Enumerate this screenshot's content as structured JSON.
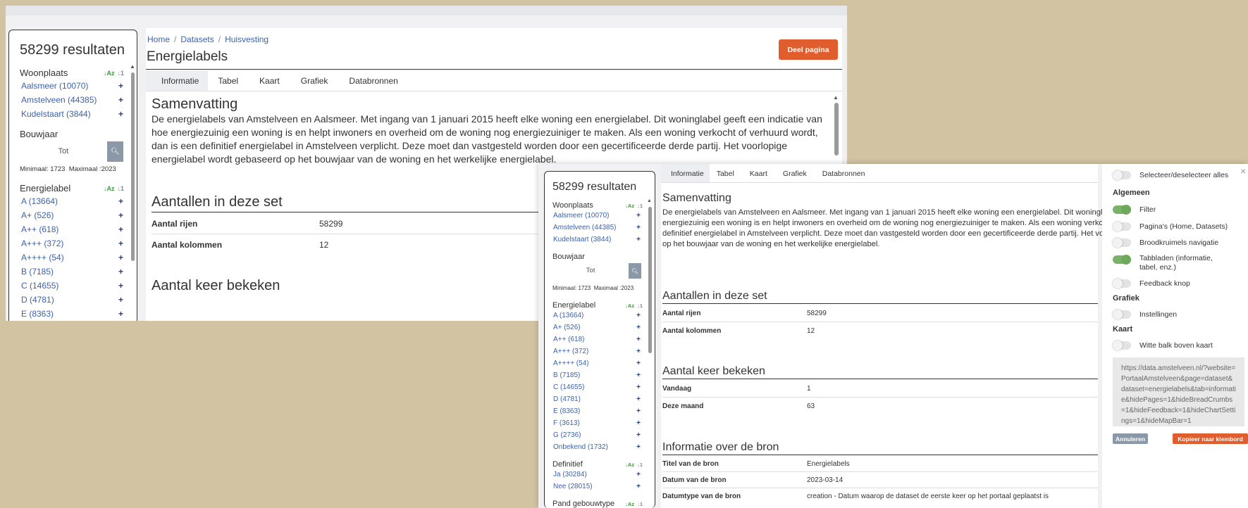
{
  "results_label": "58299 resultaten",
  "filters": {
    "woonplaats": {
      "title": "Woonplaats",
      "items": [
        "Aalsmeer (10070)",
        "Amstelveen (44385)",
        "Kudelstaart (3844)"
      ]
    },
    "bouwjaar": {
      "title": "Bouwjaar",
      "placeholder": "Tot",
      "min_label": "Minimaal: 1723",
      "max_label": "Maximaal :2023"
    },
    "energielabel": {
      "title": "Energielabel",
      "items": [
        "A (13664)",
        "A+ (526)",
        "A++ (618)",
        "A+++ (372)",
        "A++++ (54)",
        "B (7185)",
        "C (14655)",
        "D (4781)",
        "E (8363)",
        "F (3613)",
        "G (2736)",
        "Onbekend (1732)"
      ]
    },
    "definitief": {
      "title": "Definitief",
      "items": [
        "Ja (30284)",
        "Nee (28015)"
      ]
    },
    "pand": {
      "title": "Pand gebouwtype"
    },
    "plus": "+",
    "sort_az": "↓Az",
    "sort_num": "↓1"
  },
  "breadcrumb": [
    "Home",
    "Datasets",
    "Huisvesting"
  ],
  "breadcrumb_sep": "/",
  "page_title": "Energielabels",
  "share_button": "Deel pagina",
  "tabs": [
    "Informatie",
    "Tabel",
    "Kaart",
    "Grafiek",
    "Databronnen"
  ],
  "summary": {
    "title": "Samenvatting",
    "text": "De energielabels van Amstelveen en Aalsmeer. Met ingang van 1 januari 2015 heeft elke woning een energielabel. Dit woninglabel geeft een indicatie van hoe energiezuinig een woning is en helpt inwoners en overheid om de woning nog energiezuiniger te maken. Als een woning verkocht of verhuurd wordt, dan is een definitief energielabel in Amstelveen verplicht. Deze moet dan vastgesteld worden door een gecertificeerde derde partij. Het voorlopige energielabel wordt gebaseerd op het bouwjaar van de woning en het werkelijke energielabel."
  },
  "counts": {
    "title": "Aantallen in deze set",
    "rows": [
      {
        "k": "Aantal rijen",
        "v": "58299"
      },
      {
        "k": "Aantal kolommen",
        "v": "12"
      }
    ]
  },
  "views": {
    "title": "Aantal keer bekeken",
    "rows": [
      {
        "k": "Vandaag",
        "v": "1"
      },
      {
        "k": "Deze maand",
        "v": "63"
      }
    ]
  },
  "source": {
    "title": "Informatie over de bron",
    "rows": [
      {
        "k": "Titel van de bron",
        "v": "Energielabels"
      },
      {
        "k": "Datum van de bron",
        "v": "2023-03-14"
      },
      {
        "k": "Datumtype van de bron",
        "v": "creation - Datum waarop de dataset de eerste keer op het portaal geplaatst is"
      }
    ]
  },
  "embed_panel": {
    "close": "×",
    "select_all": "Selecteer/deselecteer alles",
    "groups": {
      "algemeen": "Algemeen",
      "grafiek": "Grafiek",
      "kaart": "Kaart"
    },
    "toggles": {
      "filter": "Filter",
      "paginas": "Pagina's (Home, Datasets)",
      "broodkruimels": "Broodkruimels navigatie",
      "tabbladen": "Tabbladen (informatie, tabel, enz.)",
      "feedback": "Feedback knop",
      "instellingen": "Instellingen",
      "witte_balk": "Witte balk boven kaart"
    },
    "url": "https://data.amstelveen.nl/?website=PortaalAmstelveen&page=dataset&dataset=energielabels&tab=informatie&hidePages=1&hideBreadCrumbs=1&hideFeedback=1&hideChartSettings=1&hideMapBar=1",
    "cancel": "Annuleren",
    "copy": "Kopieer naar klembord"
  },
  "colors": {
    "accent": "#e05d2d",
    "link": "#3c62ad",
    "toggle_on": "#7bb26a"
  }
}
